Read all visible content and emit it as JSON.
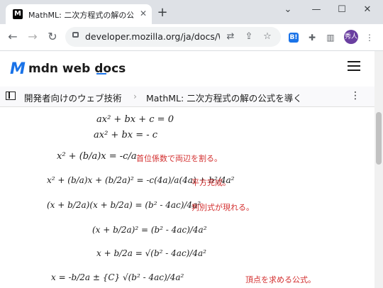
{
  "browser": {
    "tab_title": "MathML: 二次方程式の解の公式を",
    "favicon_text": "M",
    "tab_close": "✕",
    "new_tab": "+",
    "url": "developer.mozilla.org/ja/docs/We...",
    "controls": {
      "collapse": "⌄",
      "minimize": "—",
      "maximize": "☐",
      "close": "✕"
    },
    "avatar_text": "秀人",
    "ext_b_label": "B!"
  },
  "mdn": {
    "logo_mark": "M",
    "logo_text": "mdn web docs",
    "breadcrumb": [
      "開発者向けのウェブ技術",
      "MathML: 二次方程式の解の公式を導く"
    ],
    "breadcrumb_sep": "›"
  },
  "math": {
    "lines": [
      "ax² + bx + c = 0",
      "ax² + bx    = - c",
      "x² + (b/a)x    = -c/a",
      "x² + (b/a)x + (b/2a)² = -c(4a)/a(4a) + b²/4a²",
      "(x + b/2a)(x + b/2a) = (b² - 4ac)/4a²",
      "(x + b/2a)² = (b² - 4ac)/4a²",
      "x + b/2a = √(b² - 4ac)/4a²",
      "x = -b/2a ± {C} √(b² - 4ac)/4a²"
    ],
    "notes": [
      "首位係数で両辺を割る。",
      "平方完成。",
      "判別式が現れる。",
      "頂点を求める公式。"
    ]
  }
}
